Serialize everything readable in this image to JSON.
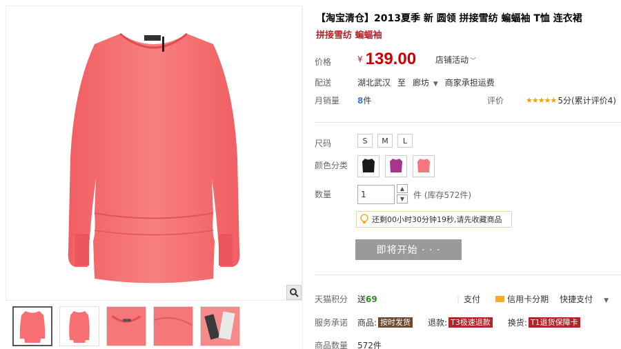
{
  "product": {
    "title": "【淘宝清仓】2013夏季 新 圆领 拼接雪纺 蝙蝠袖 T恤 连衣裙",
    "subtitle": "拼接雪纺 蝙蝠袖"
  },
  "price": {
    "label": "价格",
    "currency": "¥",
    "value": "139.00",
    "promo": "店铺活动"
  },
  "shipping": {
    "label": "配送",
    "from": "湖北武汉",
    "to_word": "至",
    "destination": "廊坊",
    "fee": "商家承担运费"
  },
  "sales": {
    "label": "月销量",
    "count": "8",
    "unit": "件",
    "rating_label": "评价",
    "rating_text": "5分(累计评价4)",
    "stars": "★★★★★"
  },
  "size": {
    "label": "尺码",
    "options": [
      "S",
      "M",
      "L"
    ]
  },
  "color": {
    "label": "颜色分类",
    "swatches": [
      "#1a1a1a",
      "#a5358d",
      "#f5777e"
    ]
  },
  "quantity": {
    "label": "数量",
    "value": "1",
    "stock": "件 (库存572件)"
  },
  "notice": {
    "text": "还剩00小时30分钟19秒,请先收藏商品"
  },
  "buy": {
    "label": "即将开始 · · ·"
  },
  "points": {
    "label": "天猫积分",
    "prefix": "送",
    "value": "69",
    "pay_label": "支付",
    "credit": "信用卡分期",
    "quick": "快捷支付"
  },
  "service": {
    "label": "服务承诺",
    "item1_prefix": "商品:",
    "item1_badge": "按时发货",
    "item2_prefix": "退款:",
    "item2_badge": "T3极速退款",
    "item3_prefix": "换货:",
    "item3_badge": "T1退货保障卡"
  },
  "stock_row": {
    "label": "商品数量",
    "value": "572件"
  },
  "colors": {
    "price_red": "#cc0000",
    "accent_red": "#b4232a",
    "dress_pink": "#f76f72",
    "button_gray": "#9a9a9a"
  }
}
